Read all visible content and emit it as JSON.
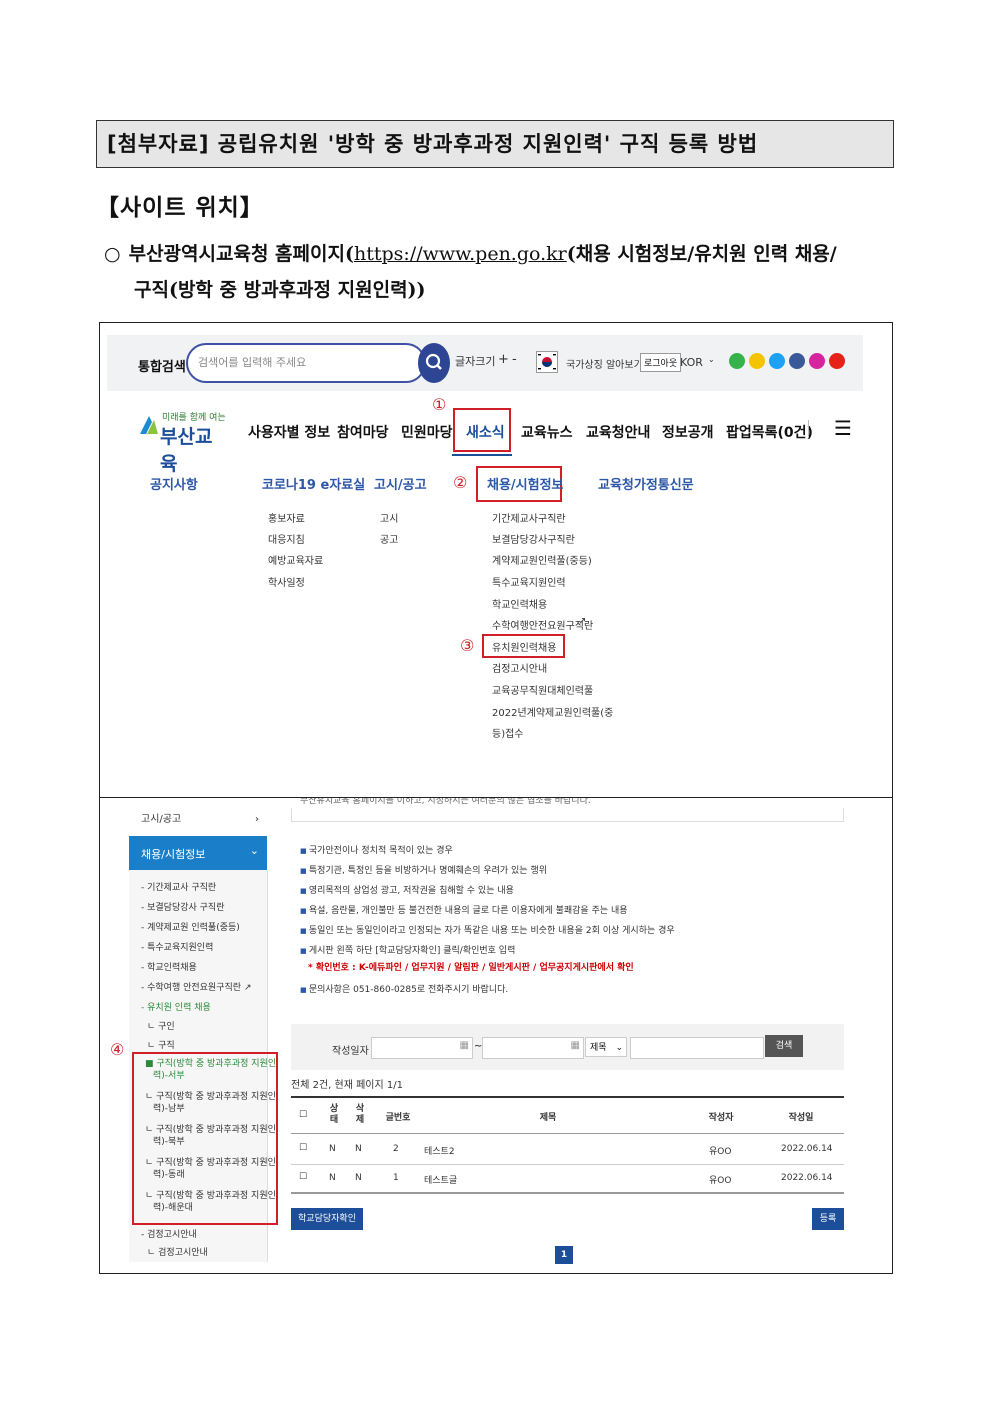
{
  "doc": {
    "title": "[첨부자료] 공립유치원 '방학 중 방과후과정 지원인력' 구직 등록 방법",
    "section": "【사이트 위치】",
    "para_marker": "○",
    "para_a": "부산광역시교육청 홈페이지(",
    "para_link": "https://www.pen.go.kr",
    "para_b": "(채용 시험정보/유치원 인력 채용/",
    "para_c": "구직(방학 중 방과후과정 지원인력))"
  },
  "panel1": {
    "search_label": "통합검색",
    "search_placeholder": "검색어를 입력해 주세요",
    "font_size_label": "글자크기",
    "plus": "+",
    "minus": "-",
    "national_symbol": "국가상징 알아보기",
    "logout": "로그아웃",
    "lang": "KOR",
    "logo_top": "미래를 함께 여는",
    "logo_main": "부산교육",
    "nav": [
      "사용자별 정보",
      "참여마당",
      "민원마당",
      "새소식",
      "교육뉴스",
      "교육청안내",
      "정보공개",
      "팝업목록(0건)"
    ],
    "menu_icon": "☰",
    "marks": [
      "①",
      "②",
      "③",
      "④"
    ],
    "sub_headers": [
      "공지사항",
      "코로나19 e자료실",
      "고시/공고",
      "채용/시험정보",
      "교육청가정통신문"
    ],
    "corona_items": [
      "홍보자료",
      "대응지침",
      "예방교육자료",
      "학사일정"
    ],
    "notice_items": [
      "고시",
      "공고"
    ],
    "recruit_items": [
      "기간제교사구직란",
      "보결담당강사구직란",
      "계약제교원인력풀(중등)",
      "특수교육지원인력",
      "학교인력채용",
      "수학여행안전요원구직란",
      "유치원인력채용",
      "검정고시안내",
      "교육공무직원대체인력풀",
      "2022년계약제교원인력풀(중",
      "등)접수"
    ]
  },
  "panel2": {
    "cut_text": "부산유치교육 홈페이지를 이하고, 시정하시는 여러분의 많은 협조를 바랍니다.",
    "lnav_top": "고시/공고",
    "lnav_active": "채용/시험정보",
    "lnav_items": [
      "기간제교사 구직란",
      "보결담당강사 구직란",
      "계약제교원 인력풀(중등)",
      "특수교육지원인력",
      "학교인력채용",
      "수학여행 안전요원구직란",
      "유치원 인력 채용"
    ],
    "lnav_sub": [
      "구인",
      "구직"
    ],
    "lnav_jobs": [
      [
        "구직(방학 중 방과후과정 지원인",
        "력)-서부"
      ],
      [
        "구직(방학 중 방과후과정 지원인",
        "력)-남부"
      ],
      [
        "구직(방학 중 방과후과정 지원인",
        "력)-북부"
      ],
      [
        "구직(방학 중 방과후과정 지원인",
        "력)-동래"
      ],
      [
        "구직(방학 중 방과후과정 지원인",
        "력)-해운대"
      ]
    ],
    "lnav_exam": "검정고시안내",
    "lnav_exam_sub": "검정고시안내",
    "bullets": [
      "국가안전이나 정치적 목적이 있는 경우",
      "특정기관, 특정인 등을 비방하거나 명예훼손의 우려가 있는 행위",
      "영리목적의 상업성 광고, 저작권을 침해할 수 있는 내용",
      "욕설, 음란물, 개인불만 등 불건전한 내용의 글로 다른 이용자에게 불쾌감을 주는 내용",
      "동일인 또는 동일인이라고 인정되는 자가 똑같은 내용 또는 비슷한 내용을 2회 이상 게시하는 경우",
      "게시판 왼쪽 하단 [학교담당자확인] 클릭/확인번호 입력"
    ],
    "confirm_note": "* 확인번호 : K-에듀파인 / 업무지원 / 알림판 / 일반게시판 / 업무공지게시판에서 확인",
    "contact": "문의사항은 051-860-0285로 전화주시기 바랍니다.",
    "filter_label": "작성일자",
    "tilde": "~",
    "select_value": "제목",
    "search_btn": "검색",
    "count_text": "전체 2건, 현재 페이지 1/1",
    "headers": [
      "상\n태",
      "삭\n제",
      "글번호",
      "제목",
      "작성자",
      "작성일"
    ],
    "rows": [
      {
        "status": "N",
        "del": "N",
        "no": "2",
        "title": "테스트2",
        "writer": "유OO",
        "date": "2022.06.14"
      },
      {
        "status": "N",
        "del": "N",
        "no": "1",
        "title": "테스트글",
        "writer": "유OO",
        "date": "2022.06.14"
      }
    ],
    "school_btn": "학교담당자확인",
    "register_btn": "등록",
    "page": "1"
  },
  "colors": {
    "accent": "#1d4e9a",
    "highlight": "#d01f27",
    "nav_active_bg": "#1a7fc8"
  }
}
